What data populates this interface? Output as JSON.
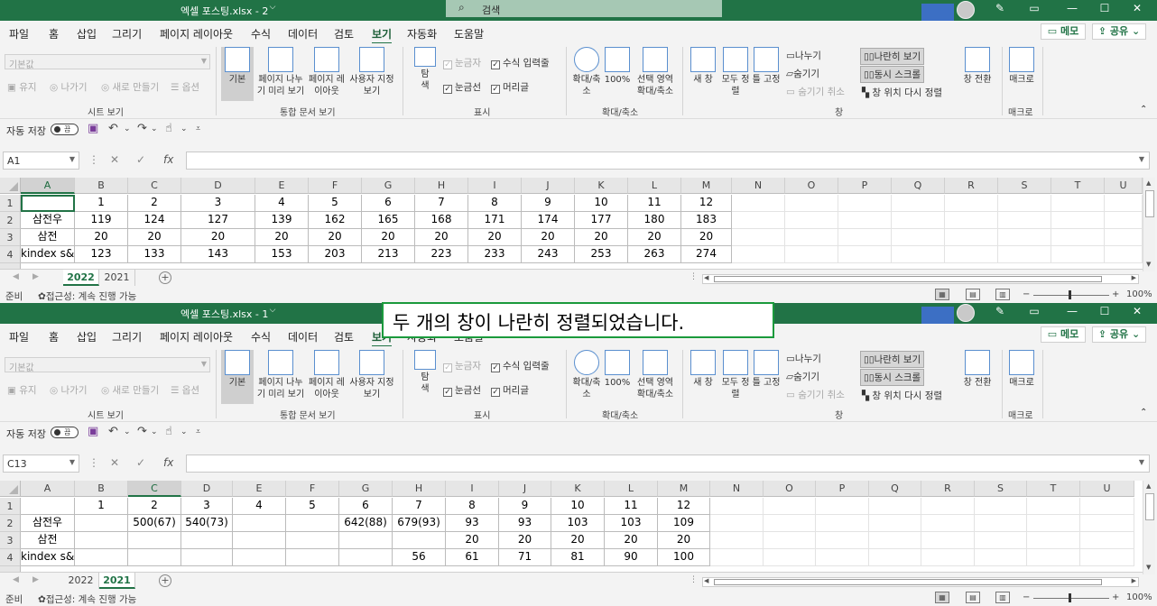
{
  "colors": {
    "excel_green": "#217346",
    "title_search_bg": "#a6c8b4",
    "notice_border": "#1a9a3c",
    "blue_block": "#3c6fc4"
  },
  "notice": "두 개의 창이 나란히 정렬되었습니다.",
  "tabs": [
    "파일",
    "홈",
    "삽입",
    "그리기",
    "페이지 레이아웃",
    "수식",
    "데이터",
    "검토",
    "보기",
    "자동화",
    "도움말"
  ],
  "active_tab": "보기",
  "memo": "메모",
  "share": "공유",
  "ribbon": {
    "sheet_view": {
      "combo": "기본값",
      "keep": "유지",
      "exit": "나가기",
      "new": "새로 만들기",
      "options": "옵션",
      "label": "시트 보기"
    },
    "workbook_views": {
      "normal": "기본",
      "page_break": "페이지 나누기 미리 보기",
      "page_layout": "페이지 레이아웃",
      "custom": "사용자 지정 보기",
      "label": "통합 문서 보기"
    },
    "show": {
      "nav": "탐색",
      "ruler": "눈금자",
      "formula_bar": "수식 입력줄",
      "gridlines": "눈금선",
      "headings": "머리글",
      "label": "표시"
    },
    "zoom": {
      "zoom": "확대/축소",
      "z100": "100%",
      "zoom_sel": "선택 영역 확대/축소",
      "label": "확대/축소"
    },
    "window": {
      "new_window": "새 창",
      "arrange_all": "모두 정렬",
      "freeze": "틀 고정",
      "split": "나누기",
      "hide": "숨기기",
      "unhide": "숨기기 취소",
      "side_by_side": "나란히 보기",
      "sync_scroll": "동시 스크롤",
      "reset_pos": "창 위치 다시 정렬",
      "switch": "창 전환",
      "label": "창"
    },
    "macros": {
      "macros": "매크로",
      "label": "매크로"
    }
  },
  "qat": {
    "autosave": "자동 저장",
    "toggle": "끔"
  },
  "status": {
    "ready": "준비",
    "accessibility": "접근성: 계속 진행 가능"
  },
  "windows": [
    {
      "title": "엑셀 포스팅.xlsx - 2",
      "search": "검색",
      "namebox": "A1",
      "zoom": "100%",
      "sheets": [
        "2022",
        "2021"
      ],
      "active_sheet": "2022",
      "rows": [
        {
          "num": "1",
          "cells": [
            "",
            "1",
            "2",
            "3",
            "4",
            "5",
            "6",
            "7",
            "8",
            "9",
            "10",
            "11",
            "12"
          ]
        },
        {
          "num": "2",
          "cells": [
            "삼전우",
            "119",
            "124",
            "127",
            "139",
            "162",
            "165",
            "168",
            "171",
            "174",
            "177",
            "180",
            "183"
          ]
        },
        {
          "num": "3",
          "cells": [
            "삼전",
            "20",
            "20",
            "20",
            "20",
            "20",
            "20",
            "20",
            "20",
            "20",
            "20",
            "20",
            "20"
          ]
        },
        {
          "num": "4",
          "cells": [
            "kindex s&p",
            "123",
            "133",
            "143",
            "153",
            "203",
            "213",
            "223",
            "233",
            "243",
            "253",
            "263",
            "274"
          ]
        }
      ]
    },
    {
      "title": "엑셀 포스팅.xlsx - 1",
      "search": "검색",
      "namebox": "C13",
      "zoom": "100%",
      "sheets": [
        "2022",
        "2021"
      ],
      "active_sheet": "2021",
      "rows": [
        {
          "num": "1",
          "cells": [
            "",
            "1",
            "2",
            "3",
            "4",
            "5",
            "6",
            "7",
            "8",
            "9",
            "10",
            "11",
            "12"
          ]
        },
        {
          "num": "2",
          "cells": [
            "삼전우",
            "",
            "500(67)",
            "540(73)",
            "",
            "",
            "642(88)",
            "679(93)",
            "93",
            "93",
            "103",
            "103",
            "109"
          ]
        },
        {
          "num": "3",
          "cells": [
            "삼전",
            "",
            "",
            "",
            "",
            "",
            "",
            "",
            "20",
            "20",
            "20",
            "20",
            "20"
          ]
        },
        {
          "num": "4",
          "cells": [
            "kindex s&p",
            "",
            "",
            "",
            "",
            "",
            "",
            "56",
            "61",
            "71",
            "81",
            "90",
            "100"
          ]
        }
      ]
    }
  ],
  "cols": [
    "A",
    "B",
    "C",
    "D",
    "E",
    "F",
    "G",
    "H",
    "I",
    "J",
    "K",
    "L",
    "M",
    "N",
    "O",
    "P",
    "Q",
    "R",
    "S",
    "T",
    "U"
  ]
}
